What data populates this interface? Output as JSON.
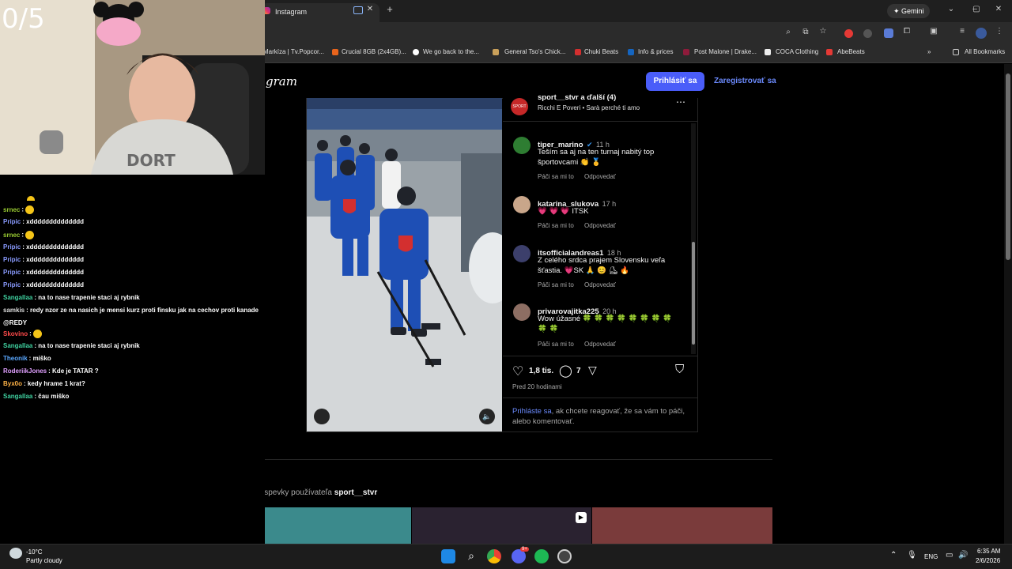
{
  "browser": {
    "tab_title": "Instagram",
    "gemini_label": "Gemini",
    "bookmarks": [
      "Markíza | Tv.Popcor...",
      "Crucial 8GB (2x4GB)...",
      "We go back to the...",
      "General Tso's Chick...",
      "Chuki Beats",
      "Info & prices",
      "Post Malone | Drake...",
      "COCA Clothing",
      "AbeBeats"
    ],
    "all_bookmarks": "All Bookmarks",
    "colors": {
      "tabbar": "#1f1f1f",
      "toolbar": "#2b2b2b"
    }
  },
  "overlay": {
    "counter": "0/5",
    "chat": [
      {
        "user": "srnec",
        "text": "",
        "color": "#9acd32",
        "emote": true
      },
      {
        "user": "Pripic",
        "text": "xdddddddddddddd",
        "color": "#8a9bff"
      },
      {
        "user": "srnec",
        "text": "",
        "color": "#9acd32",
        "emote": true
      },
      {
        "user": "Pripic",
        "text": "xdddddddddddddd",
        "color": "#8a9bff"
      },
      {
        "user": "Pripic",
        "text": "xdddddddddddddd",
        "color": "#8a9bff"
      },
      {
        "user": "Pripic",
        "text": "xdddddddddddddd",
        "color": "#8a9bff"
      },
      {
        "user": "Pripic",
        "text": "xdddddddddddddd",
        "color": "#8a9bff"
      },
      {
        "user": "Sangallaa",
        "text": "na to nase trapenie staci aj rybnik",
        "color": "#3fd1a0"
      },
      {
        "user": "samkis",
        "text": "redy nzor ze na nasich je mensi kurz proti finsku jak na cechov proti kanade",
        "color": "#dddddd"
      },
      {
        "user": "",
        "text": "@REDY",
        "color": "#ffffff"
      },
      {
        "user": "Skovino",
        "text": "",
        "color": "#ff4b4b",
        "emote": true
      },
      {
        "user": "Sangallaa",
        "text": "na to nase trapenie staci aj rybnik",
        "color": "#3fd1a0"
      },
      {
        "user": "Theonik",
        "text": "miško",
        "color": "#5aa8ff"
      },
      {
        "user": "RoderiikJones",
        "text": "Kde je TATAR ?",
        "color": "#e0a0ff"
      },
      {
        "user": "Byx0o",
        "text": "kedy hrame 1 krat?",
        "color": "#ffb347"
      },
      {
        "user": "Sangallaa",
        "text": "čau miško",
        "color": "#3fd1a0"
      }
    ]
  },
  "instagram": {
    "logo": "gram",
    "login": "Prihlásiť sa",
    "signup": "Zaregistrovať sa",
    "post_header": {
      "user": "sport__stvr a ďalší (4)",
      "audio": "Ricchi E Poveri • Sarà perché ti amo",
      "badge": "SPORT"
    },
    "comments": [
      {
        "user": "tiper_marino",
        "time": "11 h",
        "text": "Teším sa aj na ten turnaj nabitý top športovcami 👏 🥇",
        "like": "Páči sa mi to",
        "reply": "Odpovedať",
        "verified": true
      },
      {
        "user": "katarina_slukova",
        "time": "17 h",
        "text": "💗 💗 💗 ITSK",
        "like": "Páči sa mi to",
        "reply": "Odpovedať"
      },
      {
        "user": "itsofficialandreas1",
        "time": "18 h",
        "text": "Z celého srdca prajem Slovensku veľa šťastia. 💗SK 🙏 😊 ⛸ 🔥",
        "like": "Páči sa mi to",
        "reply": "Odpovedať"
      },
      {
        "user": "privarovajitka225",
        "time": "20 h",
        "text": "Wow úžasné 🍀 🍀 🍀 🍀 🍀 🍀 🍀 🍀 🍀 🍀",
        "like": "Páči sa mi to",
        "reply": "Odpovedať"
      }
    ],
    "likes": "1,8 tis.",
    "comments_count": "7",
    "posted": "Pred 20 hodinami",
    "login_prompt_link": "Prihláste sa",
    "login_prompt_rest": ", ak chcete reagovať, že sa vám to páči, alebo komentovať.",
    "more_posts_prefix": "Ďalšie príspevky používateľa",
    "more_posts_user": "sport__stvr"
  },
  "taskbar": {
    "temp": "-10°C",
    "weather": "Partly cloudy",
    "lang": "ENG",
    "time": "6:35 AM",
    "date": "2/6/2026",
    "badge": "9+"
  }
}
